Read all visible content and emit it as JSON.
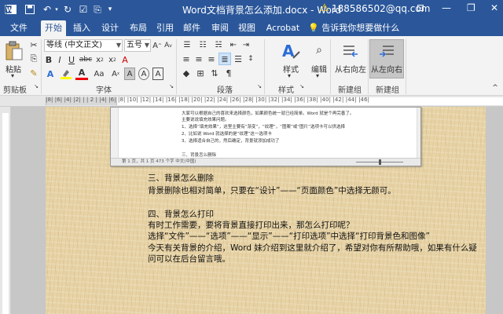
{
  "titlebar": {
    "title": "Word文档背景怎么添加.docx  -  Word",
    "account": "188586502@qq.com",
    "icons": [
      "save-icon",
      "undo-icon",
      "redo-icon",
      "checkbox-icon",
      "format-painter-icon",
      "customize-icon"
    ]
  },
  "tabs": [
    "文件",
    "开始",
    "插入",
    "设计",
    "布局",
    "引用",
    "邮件",
    "审阅",
    "视图",
    "Acrobat"
  ],
  "tell_me": "告诉我你想要做什么",
  "ribbon": {
    "paste": "粘贴",
    "font_name": "等线 (中文正文)",
    "font_size": "五号",
    "styles": "样式",
    "editing": "编辑",
    "ltr": "从右向左",
    "rtl": "从左向右",
    "groups": {
      "clipboard": "剪贴板",
      "font": "字体",
      "paragraph": "段落",
      "styles": "样式",
      "new_group_1": "新建组",
      "new_group_2": "新建组"
    }
  },
  "ruler_ticks": "|8| |6| |4| |2| |  | 2 | |4| |6| |8| |10| |12| |14| |16| |18| |20| |22| |24| |26| |28| |30| |32| |34| |36| |38| |40| |42| |44| |46|",
  "embedded_screenshot": {
    "lines": [
      "大家可以根据自己的喜欢来选择颜色，如果颜色统一就已经简单。Word 就是个再完善了。",
      "主要说说填充效果问题。",
      "1、选择“填充效果”，这里主要有“渐变”，“纹理”，“图案”或“图片”选项卡可以供选择",
      "2、比如说 Word 就选择的是“纹理”这一选项卡",
      "3、选择适合自己的，然后确定，背景就添加成功了",
      "",
      "三、背景怎么删除"
    ],
    "status": "第 1 页，共 1 页    473 个字    中文(中国)"
  },
  "document": {
    "lines": [
      "三、背景怎么删除",
      "背景删除也相对简单，只要在“设计”——“页面颜色”中选择无颜可。",
      "",
      "四、背景怎么打印",
      "有时工作需要，要将背景直接打印出来，那怎么打印呢？",
      "选择“文件”——“选项”——“显示”——“打印选项”中选择“打印背景色和图像”",
      "今天有关背景的介绍，Word 妹介绍到这里就介绍了，希望对你有所帮助哦，如果有什么疑",
      "问可以在后台留言哦。"
    ]
  },
  "colors": {
    "titlebar": "#2b579a",
    "ribbon": "#f3f3f3",
    "page_texture": "#e7d3a6"
  }
}
